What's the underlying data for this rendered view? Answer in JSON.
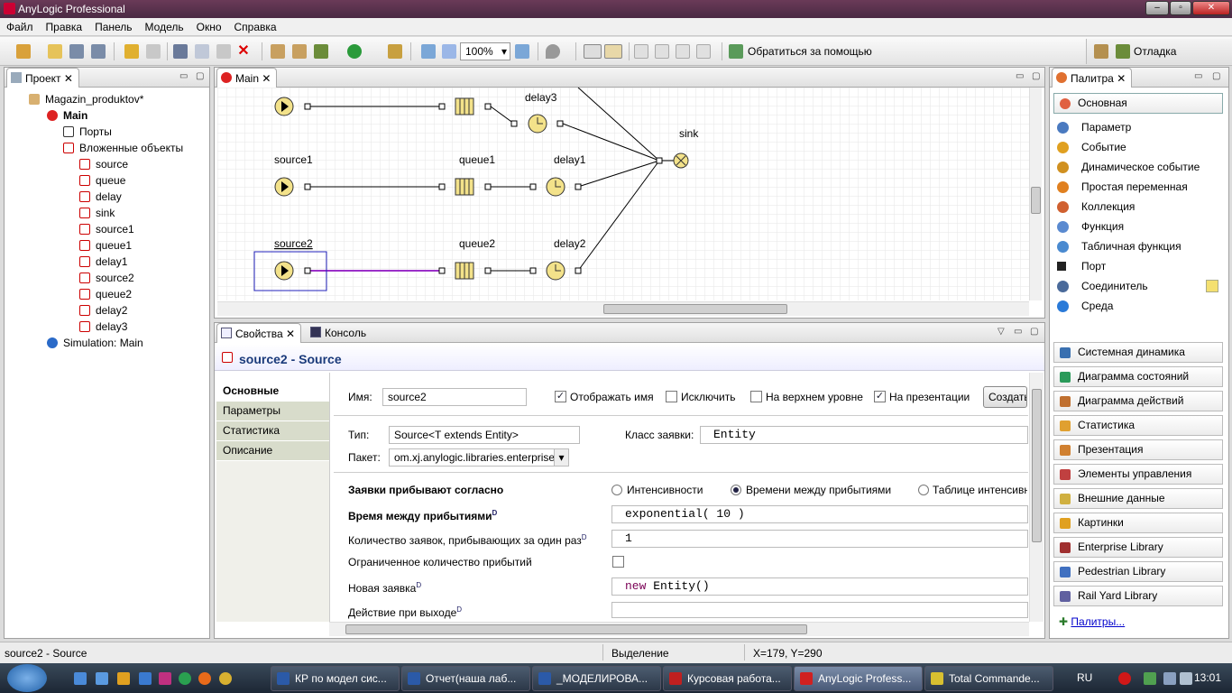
{
  "window": {
    "title": "AnyLogic Professional"
  },
  "menu": [
    "Файл",
    "Правка",
    "Панель",
    "Модель",
    "Окно",
    "Справка"
  ],
  "toolbar": {
    "zoom": "100%",
    "help_label": "Обратиться за помощью",
    "perspective_label": "Отладка"
  },
  "project_panel": {
    "tab": "Проект",
    "tree": {
      "root": "Magazin_produktov*",
      "main": "Main",
      "ports": "Порты",
      "nested": "Вложенные объекты",
      "objects": [
        "source",
        "queue",
        "delay",
        "sink",
        "source1",
        "queue1",
        "delay1",
        "source2",
        "queue2",
        "delay2",
        "delay3"
      ],
      "simulation": "Simulation: Main"
    }
  },
  "editor": {
    "tab": "Main",
    "labels": {
      "delay3": "delay3",
      "sink": "sink",
      "source1": "source1",
      "queue1": "queue1",
      "delay1": "delay1",
      "source2": "source2",
      "queue2": "queue2",
      "delay2": "delay2"
    }
  },
  "palette": {
    "tab": "Палитра",
    "section": "Основная",
    "items": [
      "Параметр",
      "Событие",
      "Динамическое событие",
      "Простая переменная",
      "Коллекция",
      "Функция",
      "Табличная функция",
      "Порт",
      "Соединитель",
      "Среда"
    ],
    "categories": [
      "Системная динамика",
      "Диаграмма состояний",
      "Диаграмма действий",
      "Статистика",
      "Презентация",
      "Элементы управления",
      "Внешние данные",
      "Картинки",
      "Enterprise Library",
      "Pedestrian Library",
      "Rail Yard Library"
    ],
    "more": "Палитры..."
  },
  "properties": {
    "tabs": [
      "Свойства",
      "Консоль"
    ],
    "header": "source2 - Source",
    "side_tabs": [
      "Основные",
      "Параметры",
      "Статистика",
      "Описание"
    ],
    "name_label": "Имя:",
    "name_value": "source2",
    "show_name": "Отображать имя",
    "exclude": "Исключить",
    "top_level": "На верхнем уровне",
    "on_presentation": "На презентации",
    "create_button": "Создать",
    "type_label": "Тип:",
    "type_value": "Source<T extends Entity>",
    "entity_class_label": "Класс заявки:",
    "entity_class_value": "Entity",
    "package_label": "Пакет:",
    "package_value": "om.xj.anylogic.libraries.enterprise",
    "arrivals_label": "Заявки прибывают согласно",
    "arrival_options": [
      "Интенсивности",
      "Времени между прибытиями",
      "Таблице интенсивн"
    ],
    "interarrival_label": "Время между прибытиями",
    "interarrival_value": "exponential( 10 )",
    "per_arrival_label": "Количество заявок, прибывающих за один раз",
    "per_arrival_value": "1",
    "limited_label": "Ограниченное количество прибытий",
    "new_entity_label": "Новая заявка",
    "new_entity_value": "new Entity()",
    "on_exit_label": "Действие при выходе",
    "dyn_marker": "D"
  },
  "statusbar": {
    "left": "source2 - Source",
    "mode": "Выделение",
    "coords": "X=179, Y=290"
  },
  "taskbar": {
    "tasks": [
      "КР по модел сис...",
      "Отчет(наша лаб...",
      "_МОДЕЛИРОВА...",
      "Курсовая работа...",
      "AnyLogic Profess...",
      "Total Commande..."
    ],
    "lang": "RU",
    "clock": "13:01"
  }
}
